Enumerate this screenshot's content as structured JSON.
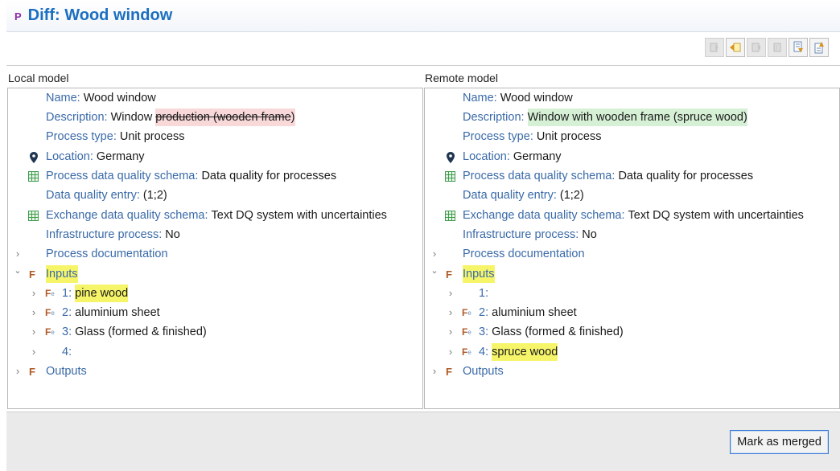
{
  "header": {
    "icon_letter": "P",
    "title": "Diff: Wood window"
  },
  "toolbar": {
    "buttons": [
      {
        "icon": "copy-all-left-icon",
        "enabled": false
      },
      {
        "icon": "copy-left-icon",
        "enabled": true
      },
      {
        "icon": "copy-right-icon",
        "enabled": false
      },
      {
        "icon": "copy-all-right-icon",
        "enabled": false
      },
      {
        "icon": "next-difference-icon",
        "enabled": true
      },
      {
        "icon": "previous-difference-icon",
        "enabled": true
      }
    ]
  },
  "local": {
    "label": "Local model",
    "name_key": "Name:",
    "name_val": "Wood window",
    "desc_key": "Description:",
    "desc_val_plain": "Window",
    "desc_val_removed": "production (wooden frame",
    "desc_val_tail": ")",
    "ptype_key": "Process type:",
    "ptype_val": "Unit process",
    "loc_key": "Location:",
    "loc_val": "Germany",
    "pdq_key": "Process data quality schema:",
    "pdq_val": "Data quality for processes",
    "dqe_key": "Data quality entry:",
    "dqe_val": "(1;2)",
    "edq_key": "Exchange data quality schema:",
    "edq_val": "Text DQ system with uncertainties",
    "infra_key": "Infrastructure process:",
    "infra_val": "No",
    "doc_label": "Process documentation",
    "inputs_label": "Inputs",
    "inputs": [
      {
        "num": "1:",
        "val": "pine wood",
        "highlight": true,
        "icon": true
      },
      {
        "num": "2:",
        "val": "aluminium sheet",
        "highlight": false,
        "icon": true
      },
      {
        "num": "3:",
        "val": "Glass (formed & finished)",
        "highlight": false,
        "icon": true
      },
      {
        "num": "4:",
        "val": "",
        "highlight": false,
        "icon": false
      }
    ],
    "outputs_label": "Outputs"
  },
  "remote": {
    "label": "Remote model",
    "name_key": "Name:",
    "name_val": "Wood window",
    "desc_key": "Description:",
    "desc_val_added": "Window with wooden frame (spruce wood)",
    "ptype_key": "Process type:",
    "ptype_val": "Unit process",
    "loc_key": "Location:",
    "loc_val": "Germany",
    "pdq_key": "Process data quality schema:",
    "pdq_val": "Data quality for processes",
    "dqe_key": "Data quality entry:",
    "dqe_val": "(1;2)",
    "edq_key": "Exchange data quality schema:",
    "edq_val": "Text DQ system with uncertainties",
    "infra_key": "Infrastructure process:",
    "infra_val": "No",
    "doc_label": "Process documentation",
    "inputs_label": "Inputs",
    "inputs": [
      {
        "num": "1:",
        "val": "",
        "highlight": false,
        "icon": false
      },
      {
        "num": "2:",
        "val": "aluminium sheet",
        "highlight": false,
        "icon": true
      },
      {
        "num": "3:",
        "val": "Glass (formed & finished)",
        "highlight": false,
        "icon": true
      },
      {
        "num": "4:",
        "val": "spruce wood",
        "highlight": true,
        "icon": true
      }
    ],
    "outputs_label": "Outputs"
  },
  "footer": {
    "merge_label": "Mark as merged"
  },
  "colors": {
    "title": "#1b6fc0",
    "key": "#3a6aa8",
    "removed_bg": "#f8d8d8",
    "added_bg": "#d6f0d6",
    "highlight_bg": "#f6f56a",
    "flow_icon": "#b05a25"
  }
}
